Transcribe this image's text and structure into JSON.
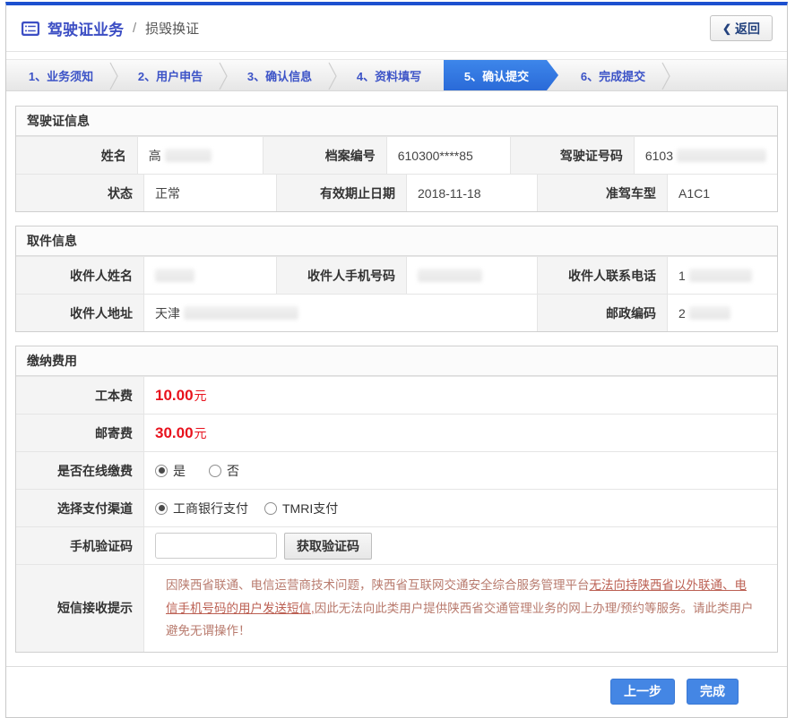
{
  "header": {
    "title": "驾驶证业务",
    "separator": "/",
    "subtitle": "损毁换证",
    "back_chevron": "❮",
    "back_label": "返回"
  },
  "steps": [
    {
      "label": "1、业务须知",
      "active": false
    },
    {
      "label": "2、用户申告",
      "active": false
    },
    {
      "label": "3、确认信息",
      "active": false
    },
    {
      "label": "4、资料填写",
      "active": false
    },
    {
      "label": "5、确认提交",
      "active": true
    },
    {
      "label": "6、完成提交",
      "active": false
    }
  ],
  "license_section": {
    "title": "驾驶证信息",
    "name_label": "姓名",
    "name_value_visible": "高",
    "file_no_label": "档案编号",
    "file_no_value": "610300****85",
    "license_no_label": "驾驶证号码",
    "license_no_value_visible": "6103",
    "status_label": "状态",
    "status_value": "正常",
    "valid_until_label": "有效期止日期",
    "valid_until_value": "2018-11-18",
    "vehicle_class_label": "准驾车型",
    "vehicle_class_value": "A1C1"
  },
  "pickup_section": {
    "title": "取件信息",
    "recipient_name_label": "收件人姓名",
    "recipient_name_value_visible": "",
    "recipient_mobile_label": "收件人手机号码",
    "recipient_mobile_value_visible": "",
    "recipient_phone_label": "收件人联系电话",
    "recipient_phone_value_visible": "1",
    "recipient_address_label": "收件人地址",
    "recipient_address_value_visible": "天津",
    "postal_code_label": "邮政编码",
    "postal_code_value_visible": "2"
  },
  "payment_section": {
    "title": "缴纳费用",
    "production_fee_label": "工本费",
    "production_fee_amount": "10.00",
    "production_fee_unit": "元",
    "postage_fee_label": "邮寄费",
    "postage_fee_amount": "30.00",
    "postage_fee_unit": "元",
    "online_pay_label": "是否在线缴费",
    "online_pay_yes": "是",
    "online_pay_no": "否",
    "online_pay_selected": "是",
    "channel_label": "选择支付渠道",
    "channel_icbc": "工商银行支付",
    "channel_tmri": "TMRI支付",
    "channel_selected": "工商银行支付",
    "sms_code_label": "手机验证码",
    "sms_code_value": "",
    "sms_code_button": "获取验证码",
    "notice_label": "短信接收提示",
    "notice_part1": "因陕西省联通、电信运营商技术问题，陕西省互联网交通安全综合服务管理平台",
    "notice_underlined": "无法向持陕西省以外联通、电信手机号码的用户发送短信,",
    "notice_part2": "因此无法向此类用户提供陕西省交通管理业务的网上办理/预约等服务。请此类用户避免无谓操作！"
  },
  "footer": {
    "prev_label": "上一步",
    "finish_label": "完成"
  },
  "colors": {
    "accent_blue": "#1c50cf",
    "title_blue": "#3c4ec4",
    "active_step_blue": "#2f7ae0",
    "button_blue": "#4486e4",
    "fee_red": "#e8121d",
    "notice_red": "#b87a6d"
  }
}
